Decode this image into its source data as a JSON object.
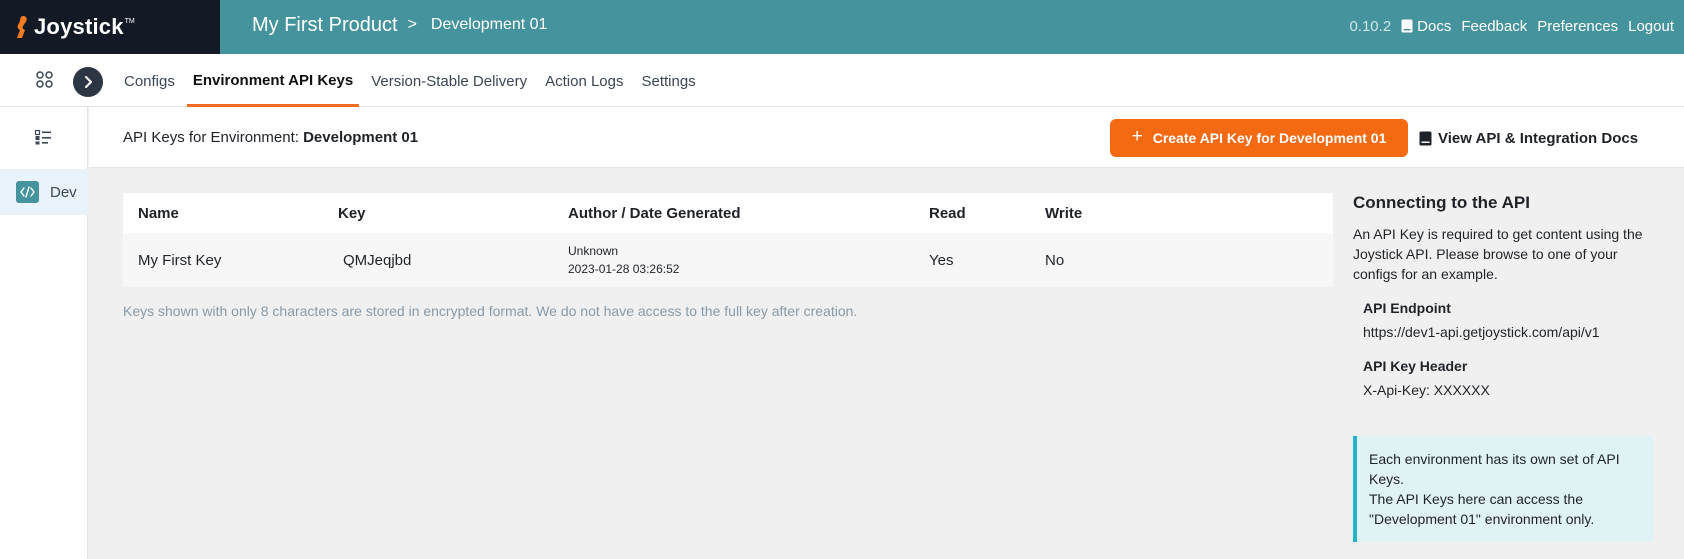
{
  "brand": {
    "name": "Joystick",
    "tm": "TM"
  },
  "breadcrumb": {
    "product": "My First Product",
    "separator": ">",
    "environment": "Development 01"
  },
  "topnav": {
    "version": "0.10.2",
    "docs": "Docs",
    "feedback": "Feedback",
    "preferences": "Preferences",
    "logout": "Logout"
  },
  "tabs": [
    {
      "label": "Configs",
      "active": false
    },
    {
      "label": "Environment API Keys",
      "active": true
    },
    {
      "label": "Version-Stable Delivery",
      "active": false
    },
    {
      "label": "Action Logs",
      "active": false
    },
    {
      "label": "Settings",
      "active": false
    }
  ],
  "sidebar": {
    "env_label": "Dev"
  },
  "header": {
    "prefix": "API Keys for Environment: ",
    "environment": "Development 01",
    "create_button": "Create API Key for Development 01",
    "docs_link": "View API & Integration Docs"
  },
  "table": {
    "columns": [
      "Name",
      "Key",
      "Author / Date Generated",
      "Read",
      "Write"
    ],
    "rows": [
      {
        "name": "My First Key",
        "key": "QMJeqjbd",
        "author": "Unknown",
        "date": "2023-01-28 03:26:52",
        "read": "Yes",
        "write": "No"
      }
    ]
  },
  "note": "Keys shown with only 8 characters are stored in encrypted format. We do not have access to the full key after creation.",
  "panel": {
    "title": "Connecting to the API",
    "description": "An API Key is required to get content using the Joystick API. Please browse to one of your configs for an example.",
    "endpoint_label": "API Endpoint",
    "endpoint_value": "https://dev1-api.getjoystick.com/api/v1",
    "header_label": "API Key Header",
    "header_value": "X-Api-Key: XXXXXX",
    "info_line1": "Each environment has its own set of API Keys.",
    "info_line2": "The API Keys here can access the \"Development 01\" environment only."
  },
  "colors": {
    "topbar": "#45939d",
    "brand_bg": "#131a26",
    "accent": "#f46a12",
    "info_border": "#1fb4c8"
  }
}
